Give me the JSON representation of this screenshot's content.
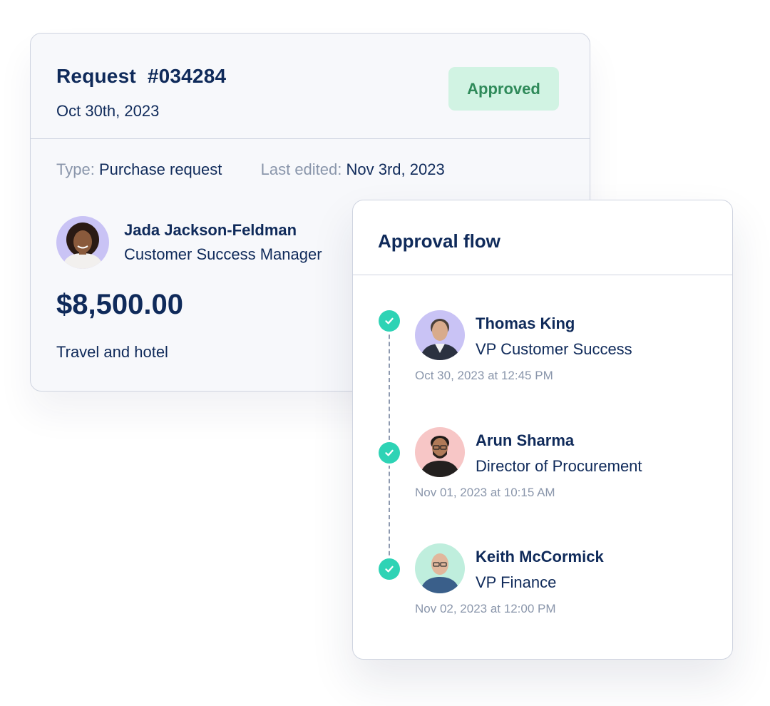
{
  "request": {
    "title": "Request  #034284",
    "date": "Oct 30th, 2023",
    "status": "Approved",
    "type_label": "Type:",
    "type_value": "Purchase request",
    "edited_label": "Last edited:",
    "edited_value": "Nov 3rd, 2023",
    "requester_name": "Jada Jackson-Feldman",
    "requester_role": "Customer Success Manager",
    "requester_avatar_icon": "person-avatar-icon",
    "amount": "$8,500.00",
    "description": "Travel and hotel"
  },
  "approval_flow": {
    "title": "Approval flow",
    "steps": [
      {
        "name": "Thomas King",
        "role": "VP Customer Success",
        "time": "Oct 30, 2023 at 12:45 PM",
        "avatar_bg": "#c9c3f5",
        "icon": "check-icon"
      },
      {
        "name": "Arun Sharma",
        "role": "Director of Procurement",
        "time": "Nov 01, 2023 at 10:15 AM",
        "avatar_bg": "#f7c6c6",
        "icon": "check-icon"
      },
      {
        "name": "Keith McCormick",
        "role": "VP Finance",
        "time": "Nov 02, 2023 at 12:00 PM",
        "avatar_bg": "#bfeedd",
        "icon": "check-icon"
      }
    ]
  },
  "colors": {
    "text_primary": "#0f2a5a",
    "text_muted": "#8a96ab",
    "badge_bg": "#d1f3e3",
    "badge_text": "#2f8a5a",
    "check": "#2ed3b5",
    "border": "#cfd4e0"
  }
}
